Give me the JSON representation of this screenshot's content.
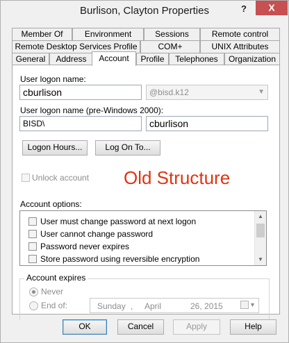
{
  "window": {
    "title": "Burlison, Clayton Properties",
    "help_glyph": "?",
    "close_glyph": "X"
  },
  "tabs": {
    "row1": [
      "Member Of",
      "Environment",
      "Sessions",
      "Remote control"
    ],
    "row2": [
      "Remote Desktop Services Profile",
      "COM+",
      "UNIX Attributes"
    ],
    "row3": [
      "General",
      "Address",
      "Account",
      "Profile",
      "Telephones",
      "Organization"
    ],
    "active": "Account"
  },
  "account": {
    "logon_name_label": "User logon name:",
    "logon_name_value": "cburlison",
    "domain_value": "@bisd.k12",
    "pre2000_label": "User logon name (pre-Windows 2000):",
    "pre2000_domain": "BISD\\",
    "pre2000_value": "cburlison",
    "logon_hours_button": "Logon Hours...",
    "log_on_to_button": "Log On To...",
    "unlock_label": "Unlock account",
    "annotation": "Old Structure",
    "options_label": "Account options:",
    "options": [
      "User must change password at next logon",
      "User cannot change password",
      "Password never expires",
      "Store password using reversible encryption"
    ],
    "expires_label": "Account expires",
    "never_label": "Never",
    "end_of_label": "End of:",
    "date": {
      "weekday": "Sunday",
      "sep": ",",
      "month": "April",
      "day_year": "26, 2015"
    }
  },
  "buttons": {
    "ok": "OK",
    "cancel": "Cancel",
    "apply": "Apply",
    "help": "Help"
  },
  "colors": {
    "close": "#c75050",
    "annotation": "#e0340f"
  }
}
